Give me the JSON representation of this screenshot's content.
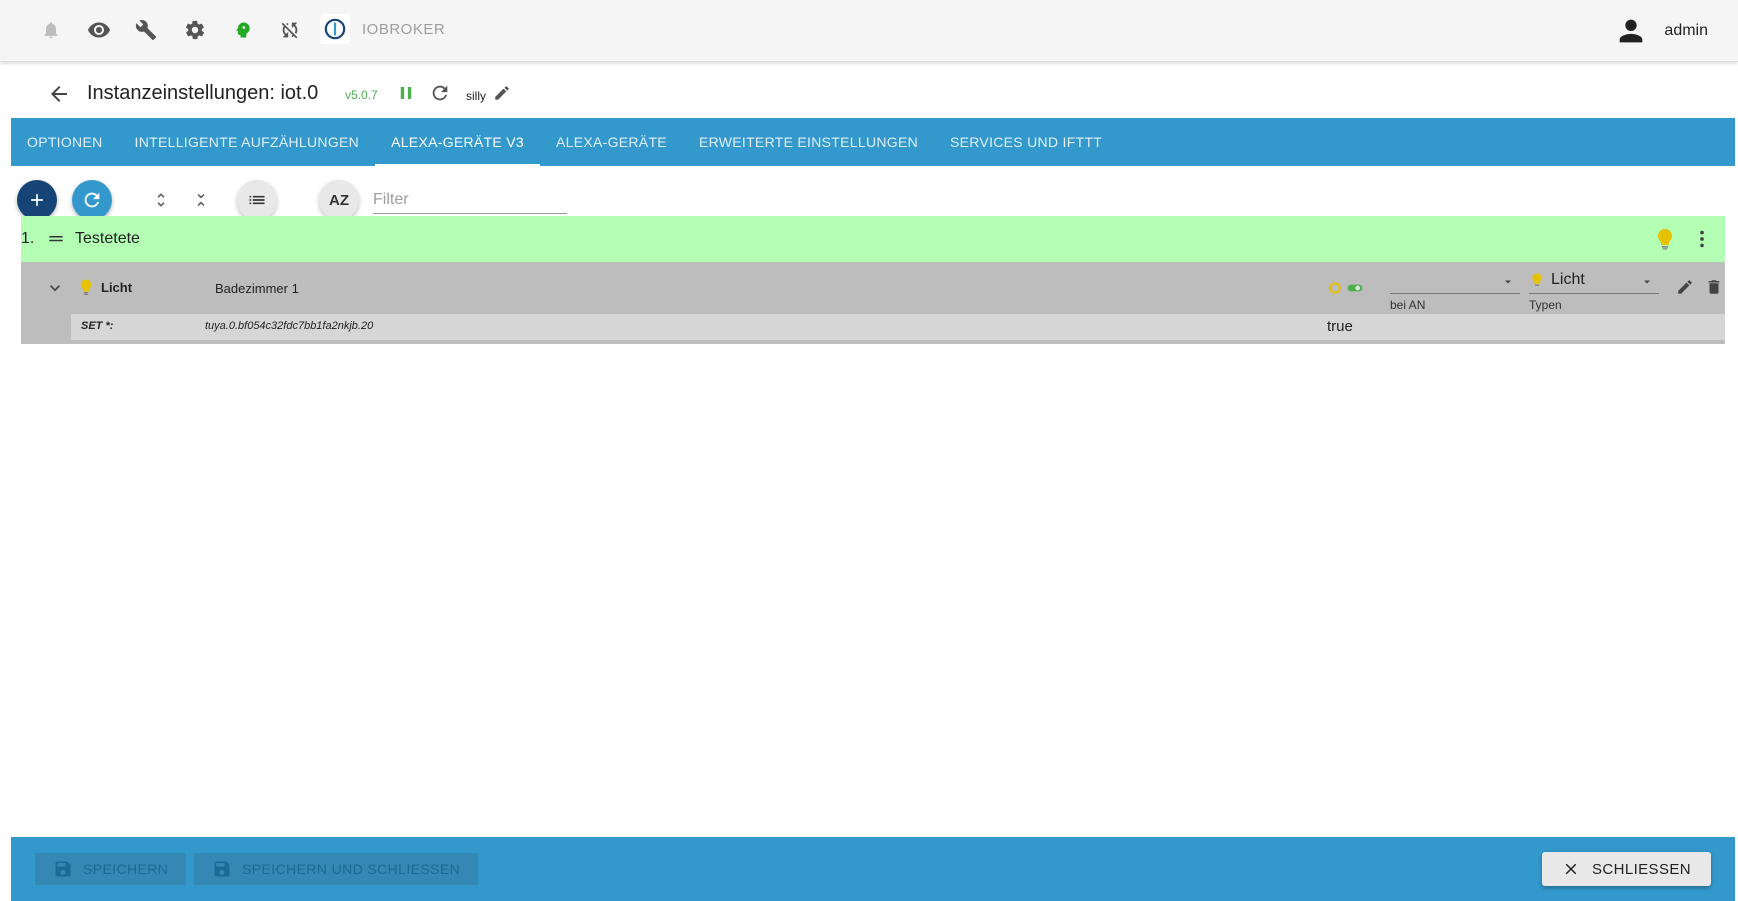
{
  "topbar": {
    "brand": "IOBROKER",
    "user": "admin",
    "icons": [
      "bell-icon",
      "eye-icon",
      "wrench-icon",
      "gear-icon",
      "head-icon",
      "sync-off-icon"
    ]
  },
  "header": {
    "title": "Instanzeinstellungen: iot.0",
    "version": "v5.0.7",
    "log_level": "silly"
  },
  "tabs": [
    {
      "label": "OPTIONEN",
      "active": false
    },
    {
      "label": "INTELLIGENTE AUFZÄHLUNGEN",
      "active": false
    },
    {
      "label": "ALEXA-GERÄTE V3",
      "active": true
    },
    {
      "label": "ALEXA-GERÄTE",
      "active": false
    },
    {
      "label": "ERWEITERTE EINSTELLUNGEN",
      "active": false
    },
    {
      "label": "SERVICES UND IFTTT",
      "active": false
    }
  ],
  "toolbar": {
    "filter_placeholder": "Filter",
    "sort_label": "AZ"
  },
  "device": {
    "index": "1.",
    "name": "Testetete",
    "capability": {
      "name": "Licht",
      "room": "Badezimmer 1",
      "on_label": "bei AN",
      "type_value": "Licht",
      "type_label": "Typen",
      "set_key": "SET *:",
      "set_id": "tuya.0.bf054c32fdc7bb1fa2nkjb.20",
      "set_value": "true"
    }
  },
  "footer": {
    "save": "SPEICHERN",
    "save_close": "SPEICHERN UND SCHLIESSEN",
    "close": "SCHLIESSEN"
  },
  "colors": {
    "accent": "#3399cc",
    "device_bg": "#b3ffb3",
    "bulb": "#e6c200",
    "green": "#4caf50"
  }
}
